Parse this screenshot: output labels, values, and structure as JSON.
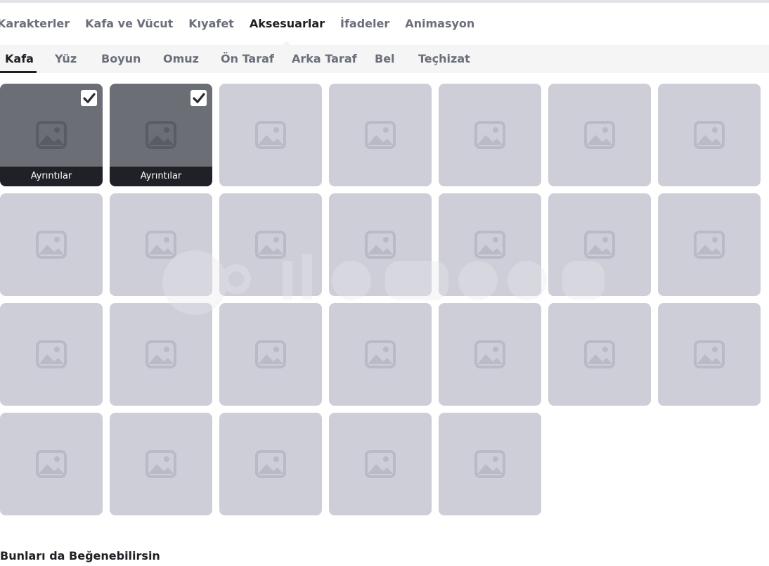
{
  "main_tabs": [
    {
      "label": "Karakterler"
    },
    {
      "label": "Kafa ve Vücut"
    },
    {
      "label": "Kıyafet"
    },
    {
      "label": "Aksesuarlar"
    },
    {
      "label": "İfadeler"
    },
    {
      "label": "Animasyon"
    }
  ],
  "main_active_index": 3,
  "sub_tabs": [
    {
      "label": "Kafa"
    },
    {
      "label": "Yüz"
    },
    {
      "label": "Boyun"
    },
    {
      "label": "Omuz"
    },
    {
      "label": "Ön Taraf"
    },
    {
      "label": "Arka Taraf"
    },
    {
      "label": "Bel"
    },
    {
      "label": "Teçhizat"
    }
  ],
  "sub_active_index": 0,
  "items": {
    "details_label": "Ayrıntılar",
    "total": 26,
    "owned_count": 2,
    "icon": "image-placeholder-icon"
  },
  "colors": {
    "tile_default": "#cdced8",
    "tile_owned": "#6c6e76",
    "details_bar": "#1f2126",
    "subnav_bg": "#f5f5f6"
  },
  "section_title": "Bunları da Beğenebilirsin"
}
